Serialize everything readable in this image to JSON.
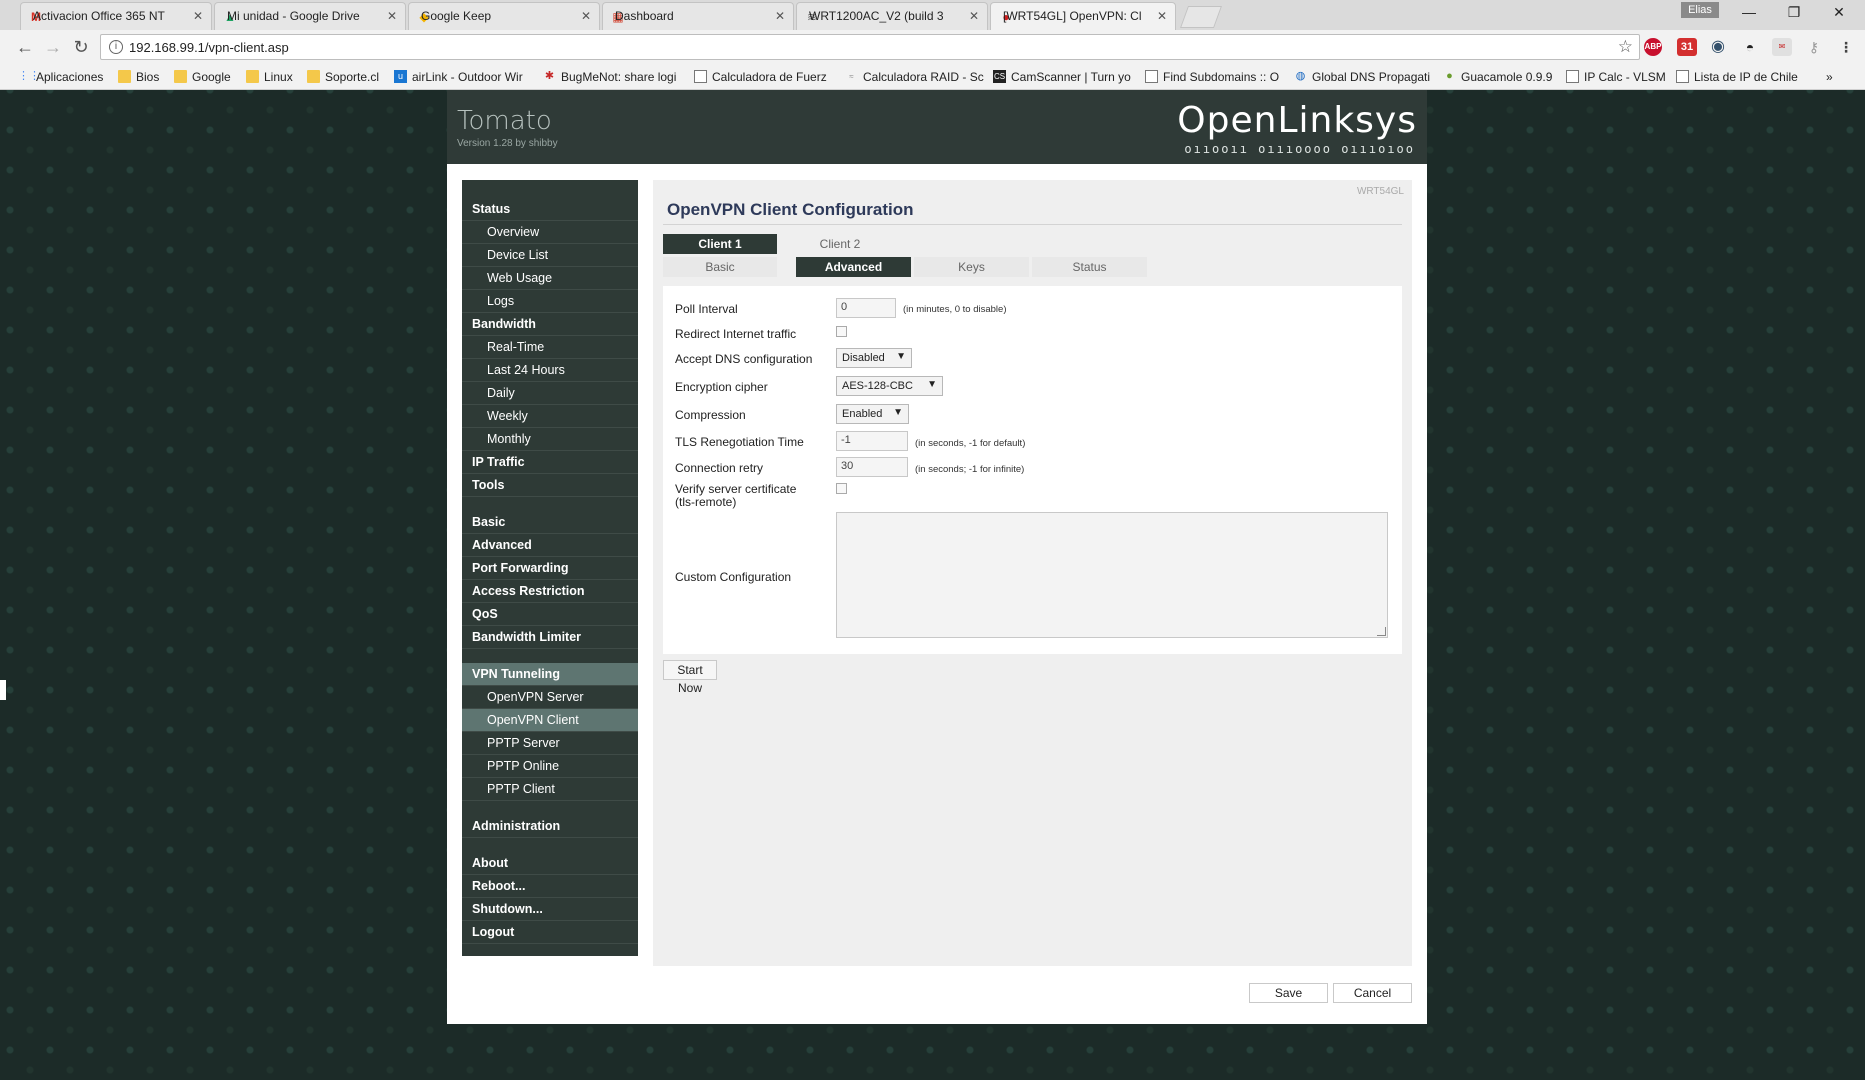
{
  "browser": {
    "tabs": [
      {
        "label": "Activacion Office 365 NT",
        "icon": "gmail-icon",
        "glyph": "M",
        "color": "#d93025"
      },
      {
        "label": "Mi unidad - Google Drive",
        "icon": "drive-icon",
        "glyph": "▲",
        "color": "#1fa463"
      },
      {
        "label": "Google Keep",
        "icon": "keep-icon",
        "glyph": "◆",
        "color": "#f4b400"
      },
      {
        "label": "Dashboard",
        "icon": "dashboard-icon",
        "glyph": "▦",
        "color": "#d14836"
      },
      {
        "label": "WRT1200AC_V2 (build 3",
        "icon": "router-icon",
        "glyph": "≋",
        "color": "#666666"
      },
      {
        "label": "[WRT54GL] OpenVPN: Cl",
        "icon": "tomato-icon",
        "glyph": "●",
        "color": "#cc1f1f"
      }
    ],
    "user": "Elias",
    "url": "192.168.99.1/vpn-client.asp",
    "bookmarks": [
      {
        "label": "Aplicaciones",
        "icon": "apps-icon"
      },
      {
        "label": "Bios",
        "icon": "folder-icon"
      },
      {
        "label": "Google",
        "icon": "folder-icon"
      },
      {
        "label": "Linux",
        "icon": "folder-icon"
      },
      {
        "label": "Soporte.cl",
        "icon": "folder-icon"
      },
      {
        "label": "airLink - Outdoor Wir",
        "icon": "airlink-icon"
      },
      {
        "label": "BugMeNot: share logi",
        "icon": "bugmenot-icon"
      },
      {
        "label": "Calculadora de Fuerz",
        "icon": "page-icon"
      },
      {
        "label": "Calculadora RAID - Sc",
        "icon": "raid-icon"
      },
      {
        "label": "CamScanner | Turn yo",
        "icon": "camscanner-icon"
      },
      {
        "label": "Find Subdomains :: O",
        "icon": "page-icon"
      },
      {
        "label": "Global DNS Propagati",
        "icon": "globe-icon"
      },
      {
        "label": "Guacamole 0.9.9",
        "icon": "guacamole-icon"
      },
      {
        "label": "IP Calc - VLSM",
        "icon": "page-icon"
      },
      {
        "label": "Lista de IP de Chile",
        "icon": "page-icon"
      }
    ],
    "more": "»"
  },
  "router": {
    "brand_left": "Tomato",
    "version": "Version 1.28 by shibby",
    "brand_right": "OpenLinksys",
    "brand_binary": "oııooıı oıııoooo oıııoıoo",
    "router_id": "WRT54GL",
    "title": "OpenVPN Client Configuration",
    "client_tabs": [
      "Client 1",
      "Client 2"
    ],
    "sub_tabs": [
      "Basic",
      "Advanced",
      "Keys",
      "Status"
    ],
    "sidebar": [
      {
        "label": "Status",
        "type": "h"
      },
      {
        "label": "Overview",
        "type": "s"
      },
      {
        "label": "Device List",
        "type": "s"
      },
      {
        "label": "Web Usage",
        "type": "s"
      },
      {
        "label": "Logs",
        "type": "s"
      },
      {
        "label": "Bandwidth",
        "type": "h"
      },
      {
        "label": "Real-Time",
        "type": "s"
      },
      {
        "label": "Last 24 Hours",
        "type": "s"
      },
      {
        "label": "Daily",
        "type": "s"
      },
      {
        "label": "Weekly",
        "type": "s"
      },
      {
        "label": "Monthly",
        "type": "s"
      },
      {
        "label": "IP Traffic",
        "type": "h"
      },
      {
        "label": "Tools",
        "type": "h"
      },
      {
        "label": "",
        "type": "gap"
      },
      {
        "label": "Basic",
        "type": "h"
      },
      {
        "label": "Advanced",
        "type": "h"
      },
      {
        "label": "Port Forwarding",
        "type": "h"
      },
      {
        "label": "Access Restriction",
        "type": "h"
      },
      {
        "label": "QoS",
        "type": "h"
      },
      {
        "label": "Bandwidth Limiter",
        "type": "h"
      },
      {
        "label": "",
        "type": "gap"
      },
      {
        "label": "VPN Tunneling",
        "type": "h",
        "active": true
      },
      {
        "label": "OpenVPN Server",
        "type": "s"
      },
      {
        "label": "OpenVPN Client",
        "type": "s",
        "active": true
      },
      {
        "label": "PPTP Server",
        "type": "s"
      },
      {
        "label": "PPTP Online",
        "type": "s"
      },
      {
        "label": "PPTP Client",
        "type": "s"
      },
      {
        "label": "",
        "type": "gap"
      },
      {
        "label": "Administration",
        "type": "h"
      },
      {
        "label": "",
        "type": "gap"
      },
      {
        "label": "About",
        "type": "h"
      },
      {
        "label": "Reboot...",
        "type": "h"
      },
      {
        "label": "Shutdown...",
        "type": "h"
      },
      {
        "label": "Logout",
        "type": "h"
      }
    ],
    "form": {
      "poll_label": "Poll Interval",
      "poll_value": "0",
      "poll_hint": "(in minutes, 0 to disable)",
      "redirect_label": "Redirect Internet traffic",
      "dns_label": "Accept DNS configuration",
      "dns_value": "Disabled",
      "cipher_label": "Encryption cipher",
      "cipher_value": "AES-128-CBC",
      "compression_label": "Compression",
      "compression_value": "Enabled",
      "tls_label": "TLS Renegotiation Time",
      "tls_value": "-1",
      "tls_hint": "(in seconds, -1 for default)",
      "retry_label": "Connection retry",
      "retry_value": "30",
      "retry_hint": "(in seconds; -1 for infinite)",
      "verify_label_1": "Verify server certificate",
      "verify_label_2": "(tls-remote)",
      "custom_label": "Custom Configuration"
    },
    "start_button": "Start Now",
    "save_button": "Save",
    "cancel_button": "Cancel"
  }
}
